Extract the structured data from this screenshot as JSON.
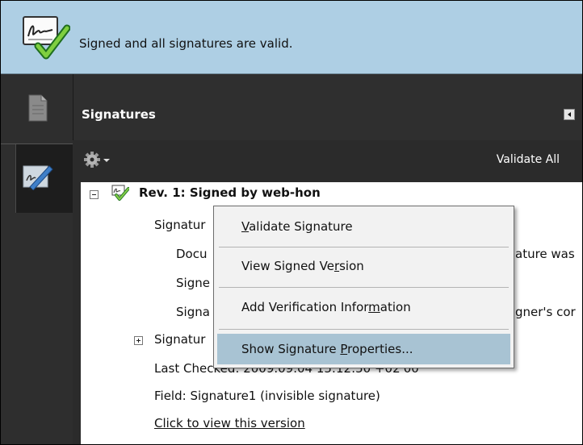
{
  "message_bar": {
    "text": "Signed and all signatures are valid.",
    "icon": "signature-valid-icon"
  },
  "left_rail": {
    "tabs": [
      {
        "name": "pages",
        "icon": "page-thumbnails-icon"
      },
      {
        "name": "signatures",
        "icon": "signature-pen-icon",
        "active": true
      }
    ]
  },
  "panel": {
    "title": "Signatures",
    "collapse_icon": "collapse-arrow-icon",
    "toolbar": {
      "options_icon": "gear-icon",
      "validate_all": "Validate All"
    }
  },
  "tree": {
    "revision": "Rev. 1: Signed by web-hon",
    "rows": [
      {
        "text": "Signatur"
      },
      {
        "text": "Docu",
        "tail": "ature was"
      },
      {
        "text": "Signe"
      },
      {
        "text": "Signa",
        "tail": "gner's cor"
      },
      {
        "text": "Signatur"
      },
      {
        "text": "Last Checked: 2009.09.04 15:12:50 +02'00'"
      },
      {
        "text": "Field: Signature1 (invisible signature)"
      },
      {
        "text": "Click to view this version"
      }
    ]
  },
  "context_menu": {
    "items": [
      {
        "pre": "",
        "key": "V",
        "post": "alidate Signature"
      },
      {
        "pre": "View Signed Ve",
        "key": "r",
        "post": "sion"
      },
      {
        "pre": "Add Verification Infor",
        "key": "m",
        "post": "ation"
      },
      {
        "pre": "Show Signature ",
        "key": "P",
        "post": "roperties..."
      }
    ]
  },
  "colors": {
    "message_bar": "#aecfe4",
    "panel_dark": "#2b2b2b",
    "menu_highlight": "#a8c3d3"
  }
}
